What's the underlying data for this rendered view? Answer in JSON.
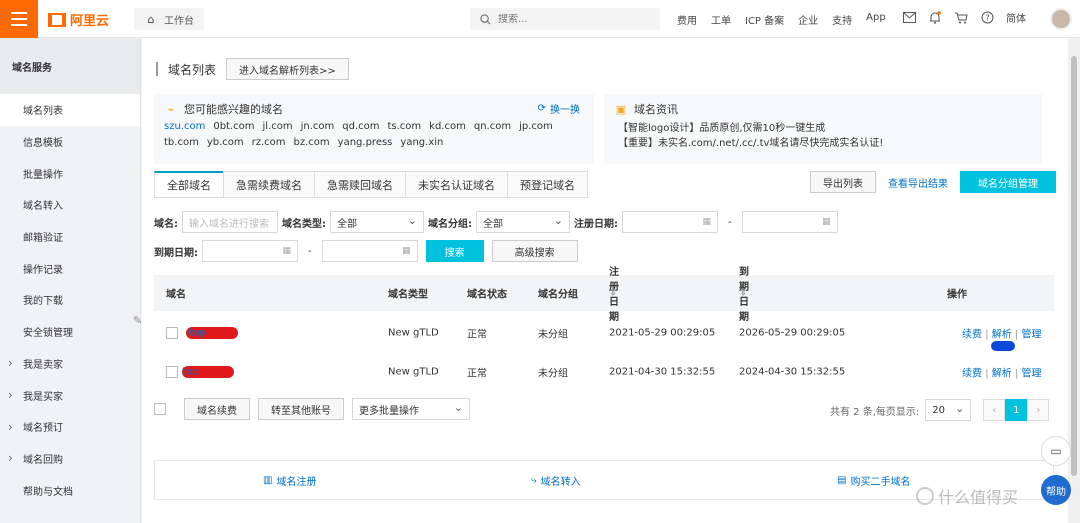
{
  "topbar": {
    "logo": "阿里云",
    "workbench": "工作台",
    "search_placeholder": "搜索...",
    "nav": [
      "费用",
      "工单",
      "ICP 备案",
      "企业",
      "支持",
      "App"
    ],
    "lang": "简体"
  },
  "sidebar": {
    "title": "域名服务",
    "items": [
      {
        "label": "域名列表"
      },
      {
        "label": "信息模板"
      },
      {
        "label": "批量操作"
      },
      {
        "label": "域名转入"
      },
      {
        "label": "邮箱验证"
      },
      {
        "label": "操作记录"
      },
      {
        "label": "我的下载"
      },
      {
        "label": "安全锁管理"
      },
      {
        "label": "我是卖家"
      },
      {
        "label": "我是买家"
      },
      {
        "label": "域名预订"
      },
      {
        "label": "域名回购"
      },
      {
        "label": "帮助与文档"
      }
    ]
  },
  "header": {
    "title": "域名列表",
    "dns_button": "进入域名解析列表>>"
  },
  "interest": {
    "title": "您可能感兴趣的域名",
    "refresh": "换一换",
    "domains": [
      "szu.com",
      "0bt.com",
      "jl.com",
      "jn.com",
      "qd.com",
      "ts.com",
      "kd.com",
      "qn.com",
      "jp.com",
      "tb.com",
      "yb.com",
      "rz.com",
      "bz.com",
      "yang.press",
      "yang.xin"
    ]
  },
  "news": {
    "title": "域名资讯",
    "items": [
      "【智能logo设计】品质原创,仅需10秒一键生成",
      "【重要】未实名.com/.net/.cc/.tv域名请尽快完成实名认证!"
    ]
  },
  "tabs": [
    "全部域名",
    "急需续费域名",
    "急需赎回域名",
    "未实名认证域名",
    "预登记域名"
  ],
  "actions": {
    "export": "导出列表",
    "view_export": "查看导出结果",
    "group_manage": "域名分组管理"
  },
  "filters": {
    "name_label": "域名:",
    "name_placeholder": "输入域名进行搜索",
    "type_label": "域名类型:",
    "type_value": "全部",
    "group_label": "域名分组:",
    "group_value": "全部",
    "reg_date_label": "注册日期:",
    "exp_date_label": "到期日期:",
    "dash": "-",
    "search": "搜索",
    "advanced": "高级搜索"
  },
  "table": {
    "headers": [
      "域名",
      "域名类型",
      "域名状态",
      "域名分组",
      "注册日期",
      "到期日期",
      "操作"
    ],
    "rows": [
      {
        "prefix": "m",
        "suffix": ".top",
        "type": "New gTLD",
        "status": "正常",
        "group": "未分组",
        "reg": "2021-05-29 00:29:05",
        "exp": "2026-05-29 00:29:05",
        "ops": [
          "续费",
          "解析",
          "管理"
        ]
      },
      {
        "prefix": "",
        "suffix": "top",
        "type": "New gTLD",
        "status": "正常",
        "group": "未分组",
        "reg": "2021-04-30 15:32:55",
        "exp": "2024-04-30 15:32:55",
        "ops": [
          "续费",
          "解析",
          "管理"
        ]
      }
    ],
    "op_sep": "|"
  },
  "bulk": {
    "renew": "域名续费",
    "transfer": "转至其他账号",
    "more": "更多批量操作"
  },
  "pager": {
    "summary": "共有 2 条,每页显示:",
    "page_size": "20",
    "prev": "‹",
    "current": "1",
    "next": "›"
  },
  "footer": {
    "register": "域名注册",
    "transfer_in": "域名转入",
    "buy_second": "购买二手域名"
  },
  "watermark": "什么值得买",
  "help": "帮助"
}
